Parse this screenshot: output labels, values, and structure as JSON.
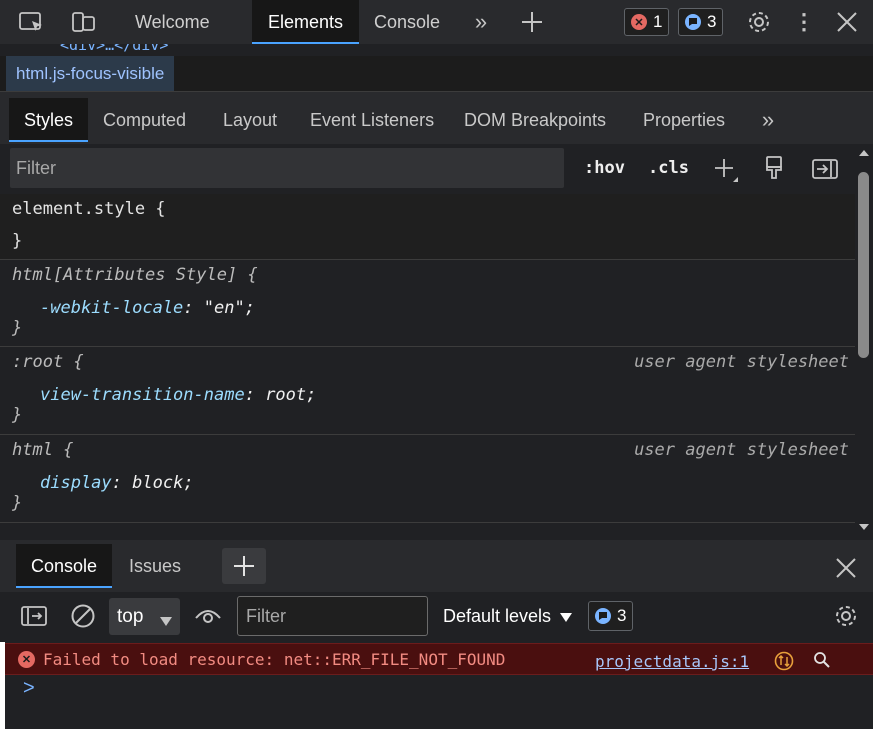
{
  "toolbar": {
    "tabs": [
      {
        "label": "Welcome"
      },
      {
        "label": "Elements"
      },
      {
        "label": "Console"
      }
    ],
    "errors_count": "1",
    "messages_count": "3"
  },
  "dom": {
    "snippet": "<div>…</div>"
  },
  "breadcrumb": {
    "tag": "html",
    "classes": ".js-focus-visible"
  },
  "styles_tabs": [
    "Styles",
    "Computed",
    "Layout",
    "Event Listeners",
    "DOM Breakpoints",
    "Properties"
  ],
  "styles_filter": {
    "placeholder": "Filter",
    "hov": ":hov",
    "cls": ".cls"
  },
  "rules": [
    {
      "selector": "element.style {",
      "close": "}",
      "origin": "",
      "props": []
    },
    {
      "selector": "html[Attributes Style] {",
      "close": "}",
      "origin": "",
      "props": [
        {
          "name": "-webkit-locale",
          "value": "\"en\";"
        }
      ]
    },
    {
      "selector": ":root {",
      "close": "}",
      "origin": "user agent stylesheet",
      "props": [
        {
          "name": "view-transition-name",
          "value": "root;"
        }
      ]
    },
    {
      "selector": "html {",
      "close": "}",
      "origin": "user agent stylesheet",
      "props": [
        {
          "name": "display",
          "value": "block;"
        }
      ]
    }
  ],
  "drawer": {
    "tabs": [
      "Console",
      "Issues"
    ],
    "context": "top",
    "filter_placeholder": "Filter",
    "levels": "Default levels",
    "issues_count": "3"
  },
  "console": {
    "error_message": "Failed to load resource: net::ERR_FILE_NOT_FOUND",
    "error_source": "projectdata.js:1",
    "prompt": ">"
  },
  "colors": {
    "accent": "#4aa3ff",
    "error_bg": "#4a0f0f",
    "error_text": "#f28b82",
    "css_property": "#9cdcfe"
  }
}
